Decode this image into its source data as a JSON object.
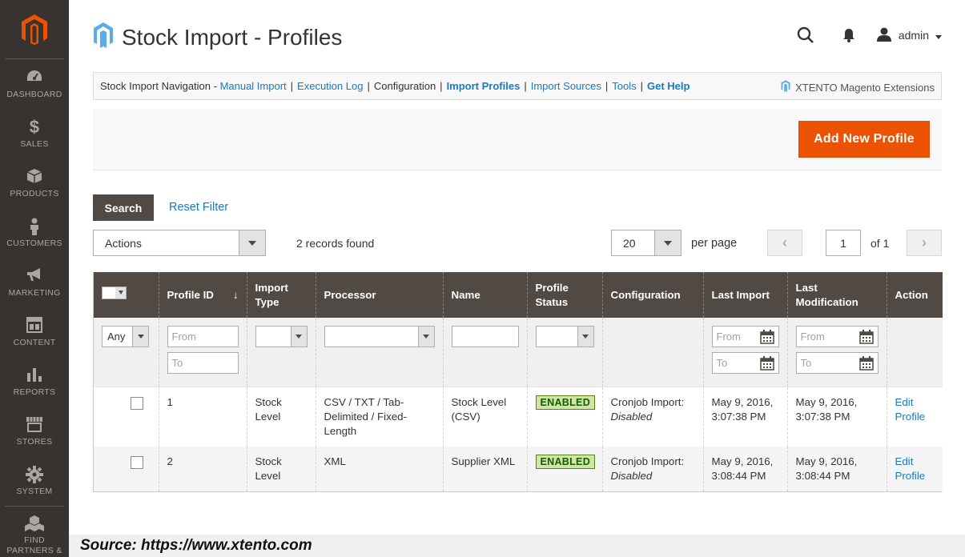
{
  "sidebar": {
    "items": [
      {
        "label": "Dashboard",
        "icon": "dashboard-icon"
      },
      {
        "label": "Sales",
        "icon": "dollar-icon"
      },
      {
        "label": "Products",
        "icon": "box-icon"
      },
      {
        "label": "Customers",
        "icon": "person-icon"
      },
      {
        "label": "Marketing",
        "icon": "megaphone-icon"
      },
      {
        "label": "Content",
        "icon": "layout-icon"
      },
      {
        "label": "Reports",
        "icon": "bar-chart-icon"
      },
      {
        "label": "Stores",
        "icon": "store-icon"
      },
      {
        "label": "System",
        "icon": "gear-icon"
      }
    ],
    "find_partners_line1": "Find",
    "find_partners_line2": "Partners &"
  },
  "header": {
    "title": "Stock Import - Profiles",
    "user": "admin"
  },
  "ext_nav": {
    "prefix": "Stock Import Navigation - ",
    "links": [
      "Manual Import",
      "Execution Log",
      "Configuration",
      "Import Profiles",
      "Import Sources",
      "Tools",
      "Get Help"
    ],
    "brand": "XTENTO Magento Extensions"
  },
  "page_actions": {
    "add_button": "Add New Profile"
  },
  "toolbar": {
    "search": "Search",
    "reset_filter": "Reset Filter",
    "actions": "Actions",
    "records_found": "2 records found",
    "per_page_value": "20",
    "per_page_label": "per page",
    "page": "1",
    "of_pages": "of 1"
  },
  "grid": {
    "columns": [
      "Profile ID",
      "Import Type",
      "Processor",
      "Name",
      "Profile Status",
      "Configuration",
      "Last Import",
      "Last Modification",
      "Action"
    ],
    "filters": {
      "any": "Any",
      "from": "From",
      "to": "To"
    },
    "rows": [
      {
        "id": "1",
        "import_type": "Stock Level",
        "processor": "CSV / TXT / Tab-Delimited / Fixed-Length",
        "name": "Stock Level (CSV)",
        "status": "ENABLED",
        "config_label": "Cronjob Import:",
        "config_value": "Disabled",
        "last_import": "May 9, 2016, 3:07:38 PM",
        "last_modification": "May 9, 2016, 3:07:38 PM",
        "action": "Edit Profile"
      },
      {
        "id": "2",
        "import_type": "Stock Level",
        "processor": "XML",
        "name": "Supplier XML",
        "status": "ENABLED",
        "config_label": "Cronjob Import:",
        "config_value": "Disabled",
        "last_import": "May 9, 2016, 3:08:44 PM",
        "last_modification": "May 9, 2016, 3:08:44 PM",
        "action": "Edit Profile"
      }
    ]
  },
  "footer": {
    "source": "Source: https://www.xtento.com"
  },
  "colors": {
    "accent": "#eb5202",
    "sidebar": "#373330",
    "header": "#514943",
    "link": "#1979c3"
  }
}
